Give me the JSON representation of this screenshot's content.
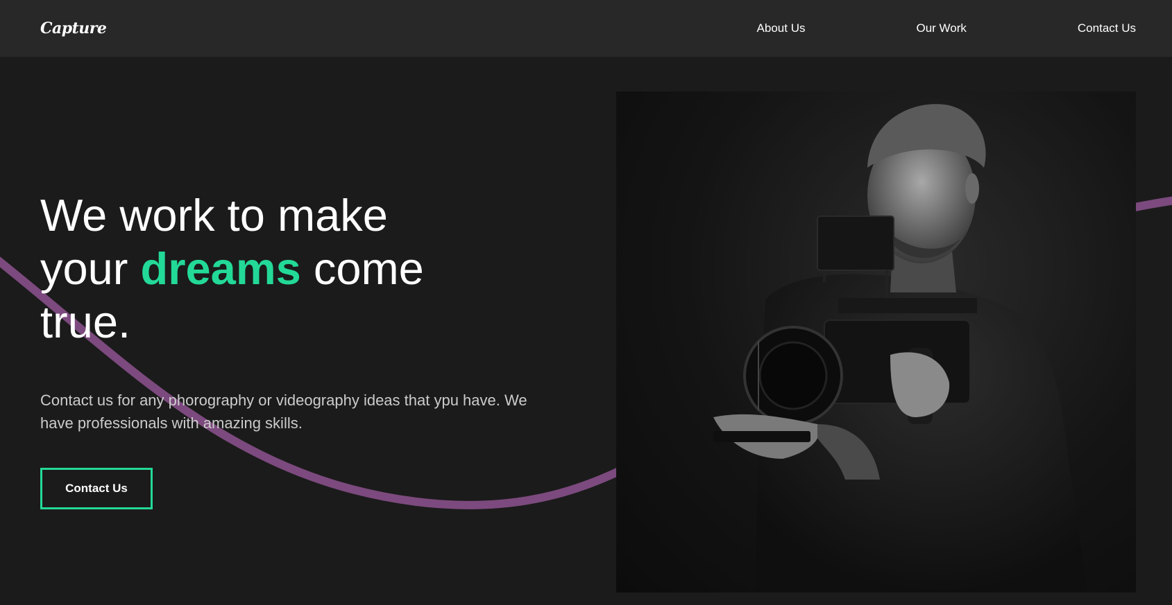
{
  "nav": {
    "logo": "Capture",
    "links": [
      {
        "label": "About Us"
      },
      {
        "label": "Our Work"
      },
      {
        "label": "Contact Us"
      }
    ]
  },
  "hero": {
    "headline_part1": "We work to make your ",
    "headline_accent": "dreams",
    "headline_part2": " come true.",
    "subtext": "Contact us for any phorography or videography ideas that ypu have. We have professionals with amazing skills.",
    "cta_label": "Contact Us",
    "image_subject": "videographer-with-camera-photo"
  },
  "colors": {
    "background": "#1b1b1b",
    "nav_background": "#282828",
    "accent": "#23d997",
    "wave": "#7c4a7e",
    "text": "#ffffff",
    "subtext": "#cccccc"
  }
}
